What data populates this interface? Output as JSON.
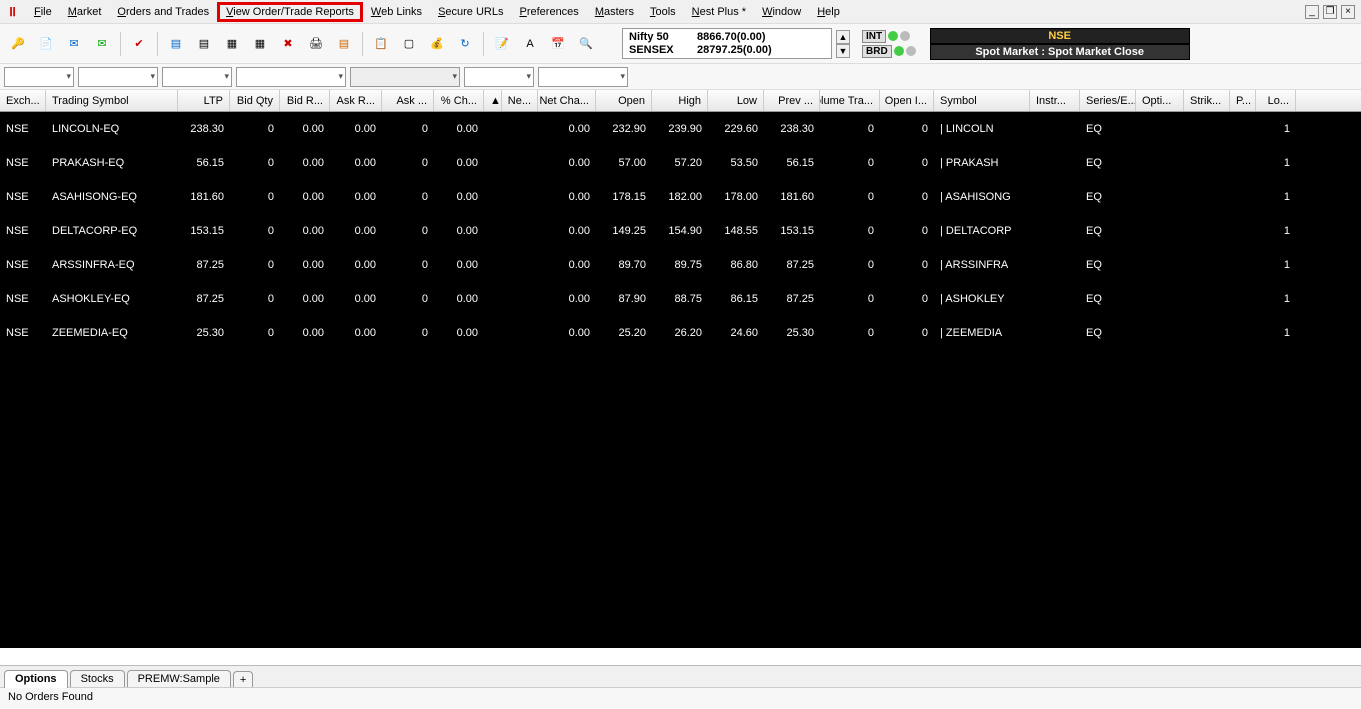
{
  "menu": {
    "items": [
      "File",
      "Market",
      "Orders and Trades",
      "View Order/Trade Reports",
      "Web Links",
      "Secure URLs",
      "Preferences",
      "Masters",
      "Tools",
      "Nest Plus *",
      "Window",
      "Help"
    ],
    "highlighted_index": 3
  },
  "window_controls": {
    "min": "_",
    "restore": "❐",
    "close": "×"
  },
  "indices": [
    {
      "name": "Nifty 50",
      "value": "8866.70(0.00)"
    },
    {
      "name": "SENSEX",
      "value": "28797.25(0.00)"
    }
  ],
  "badges": {
    "int": "INT",
    "brd": "BRD"
  },
  "market_status": {
    "top": "NSE",
    "bottom": "Spot Market : Spot Market Close"
  },
  "columns": [
    "Exch...",
    "Trading Symbol",
    "LTP",
    "Bid Qty",
    "Bid R...",
    "Ask R...",
    "Ask ...",
    "% Ch...",
    "▲",
    "Ne...",
    "Net Cha...",
    "Open",
    "High",
    "Low",
    "Prev ...",
    "Volume Tra...",
    "Open I...",
    "Symbol",
    "Instr...",
    "Series/E...",
    "Opti...",
    "Strik...",
    "P...",
    "Lo..."
  ],
  "rows": [
    {
      "ex": "NSE",
      "sym": "LINCOLN-EQ",
      "ltp": "238.30",
      "bq": "0",
      "br": "0.00",
      "ar": "0.00",
      "ap": "0",
      "pc": "0.00",
      "nc": "0.00",
      "open": "232.90",
      "high": "239.90",
      "low": "229.60",
      "prev": "238.30",
      "vol": "0",
      "oi": "0",
      "s2": "| LINCOLN",
      "se": "EQ",
      "lo": "1"
    },
    {
      "ex": "NSE",
      "sym": "PRAKASH-EQ",
      "ltp": "56.15",
      "bq": "0",
      "br": "0.00",
      "ar": "0.00",
      "ap": "0",
      "pc": "0.00",
      "nc": "0.00",
      "open": "57.00",
      "high": "57.20",
      "low": "53.50",
      "prev": "56.15",
      "vol": "0",
      "oi": "0",
      "s2": "| PRAKASH",
      "se": "EQ",
      "lo": "1"
    },
    {
      "ex": "NSE",
      "sym": "ASAHISONG-EQ",
      "ltp": "181.60",
      "bq": "0",
      "br": "0.00",
      "ar": "0.00",
      "ap": "0",
      "pc": "0.00",
      "nc": "0.00",
      "open": "178.15",
      "high": "182.00",
      "low": "178.00",
      "prev": "181.60",
      "vol": "0",
      "oi": "0",
      "s2": "| ASAHISONG",
      "se": "EQ",
      "lo": "1"
    },
    {
      "ex": "NSE",
      "sym": "DELTACORP-EQ",
      "ltp": "153.15",
      "bq": "0",
      "br": "0.00",
      "ar": "0.00",
      "ap": "0",
      "pc": "0.00",
      "nc": "0.00",
      "open": "149.25",
      "high": "154.90",
      "low": "148.55",
      "prev": "153.15",
      "vol": "0",
      "oi": "0",
      "s2": "| DELTACORP",
      "se": "EQ",
      "lo": "1"
    },
    {
      "ex": "NSE",
      "sym": "ARSSINFRA-EQ",
      "ltp": "87.25",
      "bq": "0",
      "br": "0.00",
      "ar": "0.00",
      "ap": "0",
      "pc": "0.00",
      "nc": "0.00",
      "open": "89.70",
      "high": "89.75",
      "low": "86.80",
      "prev": "87.25",
      "vol": "0",
      "oi": "0",
      "s2": "| ARSSINFRA",
      "se": "EQ",
      "lo": "1"
    },
    {
      "ex": "NSE",
      "sym": "ASHOKLEY-EQ",
      "ltp": "87.25",
      "bq": "0",
      "br": "0.00",
      "ar": "0.00",
      "ap": "0",
      "pc": "0.00",
      "nc": "0.00",
      "open": "87.90",
      "high": "88.75",
      "low": "86.15",
      "prev": "87.25",
      "vol": "0",
      "oi": "0",
      "s2": "| ASHOKLEY",
      "se": "EQ",
      "lo": "1"
    },
    {
      "ex": "NSE",
      "sym": "ZEEMEDIA-EQ",
      "ltp": "25.30",
      "bq": "0",
      "br": "0.00",
      "ar": "0.00",
      "ap": "0",
      "pc": "0.00",
      "nc": "0.00",
      "open": "25.20",
      "high": "26.20",
      "low": "24.60",
      "prev": "25.30",
      "vol": "0",
      "oi": "0",
      "s2": "| ZEEMEDIA",
      "se": "EQ",
      "lo": "1"
    }
  ],
  "tabs": [
    "Options",
    "Stocks",
    "PREMW:Sample"
  ],
  "active_tab": 0,
  "tab_add": "+",
  "statusbar": "No Orders Found"
}
